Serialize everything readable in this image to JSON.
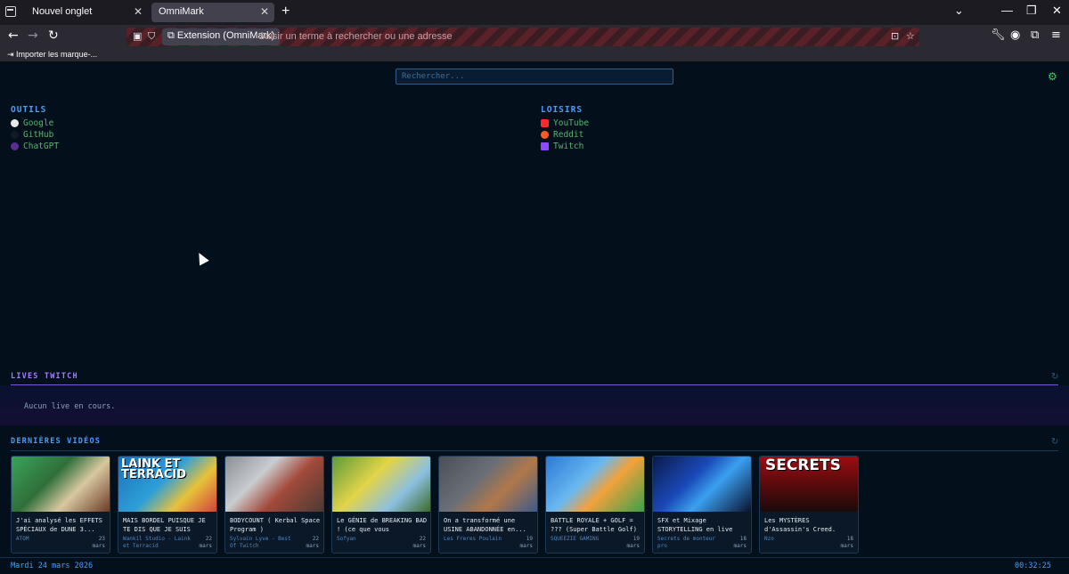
{
  "browser": {
    "tabs": [
      {
        "label": "Nouvel onglet",
        "active": false
      },
      {
        "label": "OmniMark",
        "active": true
      }
    ],
    "new_tab_symbol": "+",
    "url_bar": {
      "identity_label": "Extension (OmniMark)",
      "placeholder": "Saisir un terme à rechercher ou une adresse"
    },
    "bookmarks_bar": {
      "import_label": "Importer les marque-..."
    }
  },
  "page": {
    "search": {
      "placeholder": "Rechercher..."
    },
    "settings_icon": "gear-icon",
    "categories": [
      {
        "title": "OUTILS",
        "links": [
          {
            "label": "Google",
            "icon": "google-icon",
            "color": "#e8e8e8"
          },
          {
            "label": "GitHub",
            "icon": "github-icon",
            "color": "#0f1a24"
          },
          {
            "label": "ChatGPT",
            "icon": "chatgpt-icon",
            "color": "#5b2d91"
          }
        ]
      },
      {
        "title": "LOISIRS",
        "links": [
          {
            "label": "YouTube",
            "icon": "youtube-icon",
            "color": "#ff2a2a"
          },
          {
            "label": "Reddit",
            "icon": "reddit-icon",
            "color": "#ff5a1f"
          },
          {
            "label": "Twitch",
            "icon": "twitch-icon",
            "color": "#9146ff"
          }
        ]
      }
    ],
    "lives": {
      "title": "LIVES TWITCH",
      "empty_text": "Aucun live en cours.",
      "accent_color": "#a37dff"
    },
    "videos": {
      "title": "DERNIÈRES VIDÉOS",
      "accent_color": "#4d9df5",
      "items": [
        {
          "title": "J'ai analysé les EFFETS SPÉCIAUX de DUNE 3...",
          "channel": "ATOM",
          "date": "23 mars",
          "thumb_text": ""
        },
        {
          "title": "MAIS BORDEL PUISQUE JE TE DIS QUE JE SUIS PAS...",
          "channel": "Wankil Studio - Laink et Terracid",
          "date": "22 mars",
          "thumb_text": "LAINK ET TERRACID"
        },
        {
          "title": "BODYCOUNT ( Kerbal Space Program )",
          "channel": "Sylvain Lyve - Best Of Twitch",
          "date": "22 mars",
          "thumb_text": ""
        },
        {
          "title": "Le GÉNIE de BREAKING BAD ! (ce que vous n'aviez...",
          "channel": "Sofyan",
          "date": "22 mars",
          "thumb_text": ""
        },
        {
          "title": "On a transformé une USINE ABANDONNÉE en...",
          "channel": "Les Freres Poulain",
          "date": "19 mars",
          "thumb_text": ""
        },
        {
          "title": "BATTLE ROYALE + GOLF = ??? (Super Battle Golf)",
          "channel": "SQUEEZIE GAMING",
          "date": "19 mars",
          "thumb_text": ""
        },
        {
          "title": "SFX et Mixage STORYTELLING en live",
          "channel": "Secrets de monteur pro",
          "date": "18 mars",
          "thumb_text": ""
        },
        {
          "title": "Les MYSTÈRES d'Assassin's Creed.",
          "channel": "Nzo",
          "date": "18 mars",
          "thumb_text": "SECRETS"
        }
      ]
    },
    "footer": {
      "date": "Mardi 24 mars 2026",
      "time": "00:32:25"
    }
  }
}
